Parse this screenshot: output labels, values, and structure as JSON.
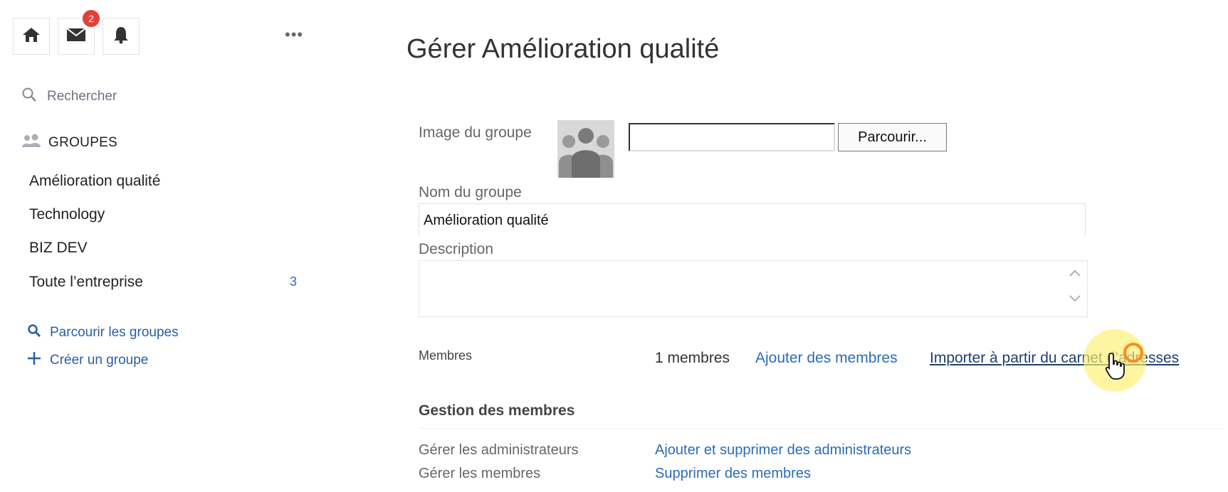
{
  "toolbar": {
    "home_icon": "home-icon",
    "mail_icon": "mail-icon",
    "mail_badge": "2",
    "bell_icon": "bell-icon",
    "more": "•••"
  },
  "sidebar": {
    "search_placeholder": "Rechercher",
    "groups_header": "GROUPES",
    "groups": [
      {
        "label": "Amélioration qualité"
      },
      {
        "label": "Technology"
      },
      {
        "label": "BIZ DEV"
      },
      {
        "label": "Toute l’entreprise",
        "count": "3"
      }
    ],
    "browse_groups": "Parcourir les groupes",
    "create_group": "Créer un groupe"
  },
  "main": {
    "title": "Gérer Amélioration qualité",
    "image_label": "Image du groupe",
    "browse_button": "Parcourir...",
    "name_label": "Nom du groupe",
    "name_value": "Amélioration qualité",
    "description_label": "Description",
    "members_label": "Membres",
    "members_count": "1 membres",
    "add_members": "Ajouter des membres",
    "import_contacts": "Importer à partir du carnet d’adresses",
    "management_title": "Gestion des membres",
    "manage_admins_label": "Gérer les administrateurs",
    "manage_admins_link": "Ajouter et supprimer des administrateurs",
    "manage_members_label": "Gérer les membres",
    "manage_members_link": "Supprimer des membres"
  },
  "colors": {
    "link": "#2a6db5",
    "badge": "#e04237",
    "cursor_highlight": "#fff06e"
  }
}
